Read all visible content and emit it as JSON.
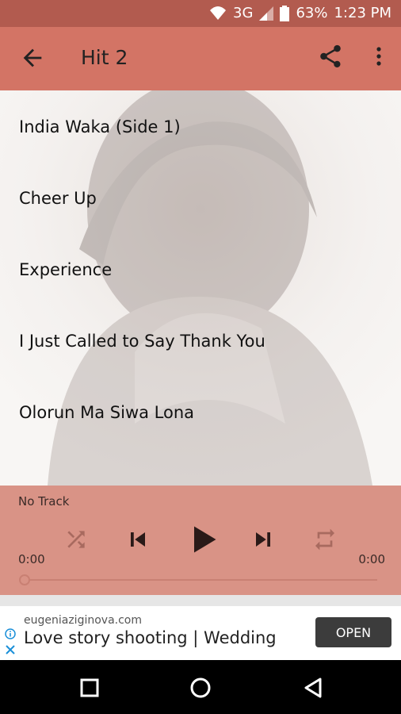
{
  "status_bar": {
    "network": "3G",
    "battery": "63%",
    "time": "1:23 PM"
  },
  "app_bar": {
    "title": "Hit 2",
    "back_icon": "arrow-back-icon",
    "share_icon": "share-icon",
    "more_icon": "more-vert-icon"
  },
  "tracks": [
    "India Waka (Side 1)",
    "Cheer Up",
    "Experience",
    "I Just Called to Say Thank You",
    "Olorun Ma Siwa Lona"
  ],
  "player": {
    "now_playing": "No Track",
    "time_elapsed": "0:00",
    "time_total": "0:00",
    "progress": 0
  },
  "ad": {
    "url": "eugeniaziginova.com",
    "title": "Love story shooting | Wedding",
    "button": "OPEN"
  },
  "colors": {
    "status_bar": "#b25b4f",
    "app_bar": "#d37465",
    "player": "#d99386"
  }
}
